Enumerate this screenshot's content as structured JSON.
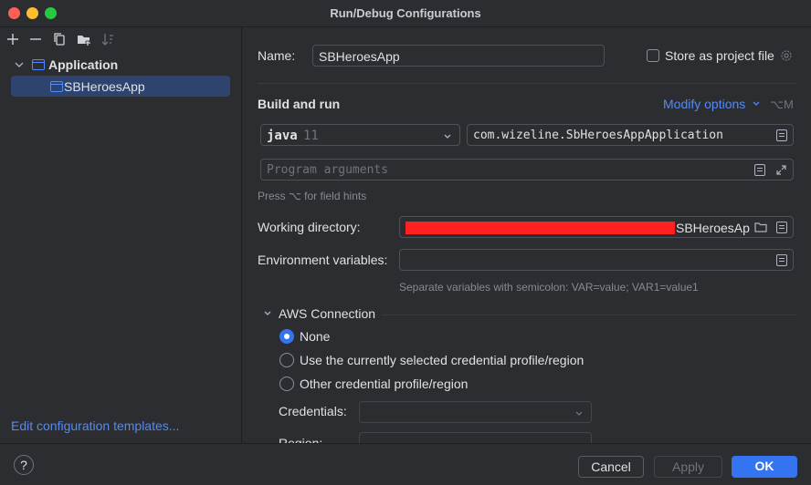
{
  "window": {
    "title": "Run/Debug Configurations",
    "traffic_light_colors": [
      "#ff5f57",
      "#febc2e",
      "#28c840"
    ]
  },
  "sidebar": {
    "toolbar": [
      {
        "icon": "plus-icon"
      },
      {
        "icon": "minus-icon"
      },
      {
        "icon": "copy-icon"
      },
      {
        "icon": "new-folder-icon"
      },
      {
        "icon": "sort-icon"
      }
    ],
    "tree": {
      "group_label": "Application",
      "item_label": "SBHeroesApp"
    },
    "edit_templates_link": "Edit configuration templates..."
  },
  "form": {
    "name_label": "Name:",
    "name_value": "SBHeroesApp",
    "store_label": "Store as project file",
    "build_run_title": "Build and run",
    "modify_options": "Modify options",
    "modify_shortcut": "⌥M",
    "jdk_name": "java",
    "jdk_version": "11",
    "main_class": "com.wizeline.SbHeroesAppApplication",
    "program_args_placeholder": "Program arguments",
    "field_hint": "Press ⌥ for field hints",
    "working_dir_label": "Working directory:",
    "working_dir_value": "SBHeroesAp",
    "env_label": "Environment variables:",
    "env_hint": "Separate variables with semicolon: VAR=value; VAR1=value1",
    "aws_title": "AWS Connection",
    "aws_options": [
      "None",
      "Use the currently selected credential profile/region",
      "Other credential profile/region"
    ],
    "aws_selected": 0,
    "credentials_label": "Credentials:",
    "region_label": "Region:"
  },
  "footer": {
    "help": "?",
    "cancel": "Cancel",
    "apply": "Apply",
    "ok": "OK"
  },
  "colors": {
    "accent": "#3574f0",
    "link": "#548af7",
    "redaction": "#ff2020",
    "background": "#2b2d30"
  }
}
